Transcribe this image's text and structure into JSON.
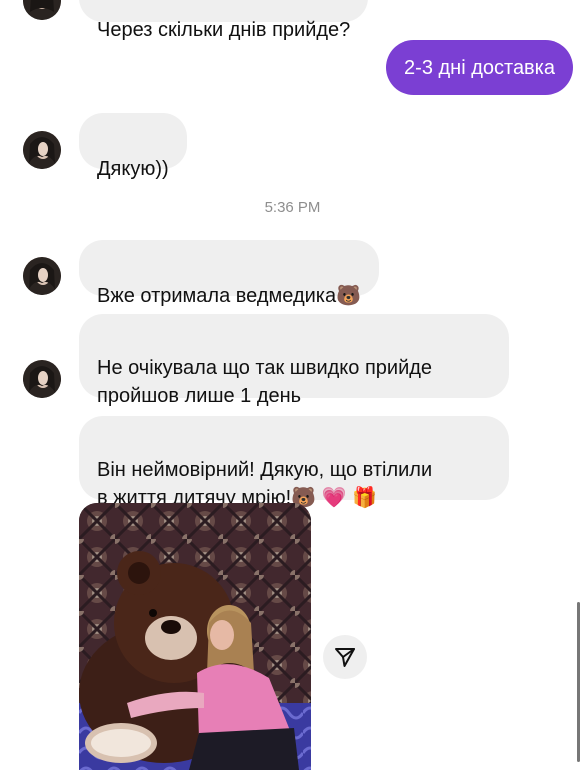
{
  "messages": {
    "partial_top": "Через скільки днів прийде?",
    "outgoing_delivery": "2-3 дні доставка",
    "thanks": "Дякую))",
    "timestamp": "5:36 PM",
    "received_bear": "Вже отримала ведмедика🐻",
    "not_expected": "Не очікувала що так швидко прийде\nпройшов лише 1 день",
    "amazing": "Він неймовірний! Дякую, що втілили\nв життя дитячу мрію!🐻 💗 🎁"
  },
  "colors": {
    "outgoing_bubble": "#7b3fd3",
    "incoming_bubble": "#efefef",
    "timestamp_text": "#8e8e8e"
  },
  "icons": {
    "share": "paper-plane-icon",
    "avatar": "user-avatar"
  }
}
